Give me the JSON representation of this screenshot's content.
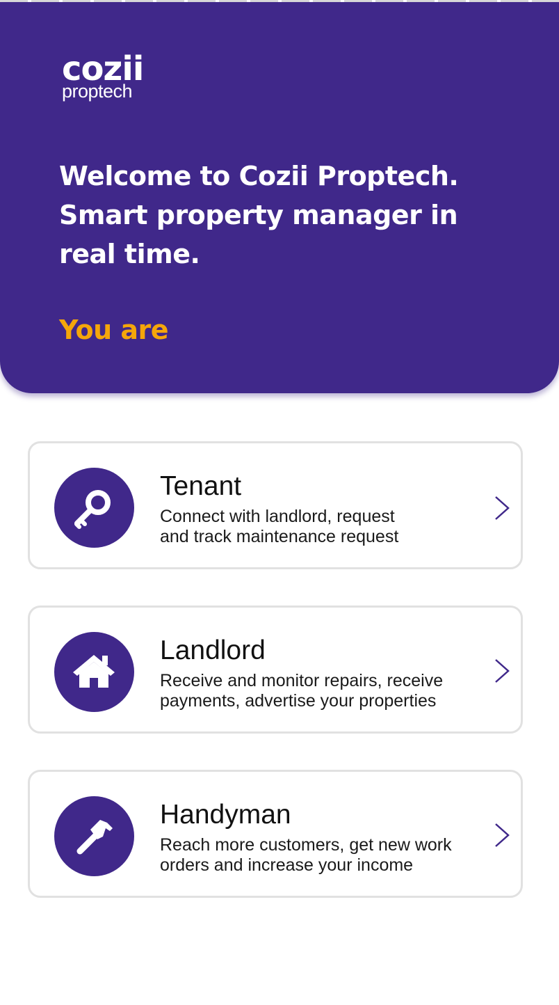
{
  "app": {
    "logo": {
      "main": "cozii",
      "sub": "proptech"
    },
    "welcome_text": "Welcome to Cozii Proptech. Smart property manager in real time.",
    "you_are_label": "You are"
  },
  "roles": [
    {
      "title": "Tenant",
      "description_line1": "Connect with landlord, request",
      "description_line2": "and track maintenance request",
      "icon": "key-icon"
    },
    {
      "title": "Landlord",
      "description_line1": "Receive and monitor repairs, receive",
      "description_line2": "payments, advertise your properties",
      "icon": "house-icon"
    },
    {
      "title": "Handyman",
      "description_line1": "Reach more customers, get new work",
      "description_line2": "orders and increase your income",
      "icon": "hammer-icon"
    }
  ],
  "colors": {
    "primary": "#40288a",
    "accent": "#f5a60a",
    "card_border": "#e1e1e1"
  }
}
